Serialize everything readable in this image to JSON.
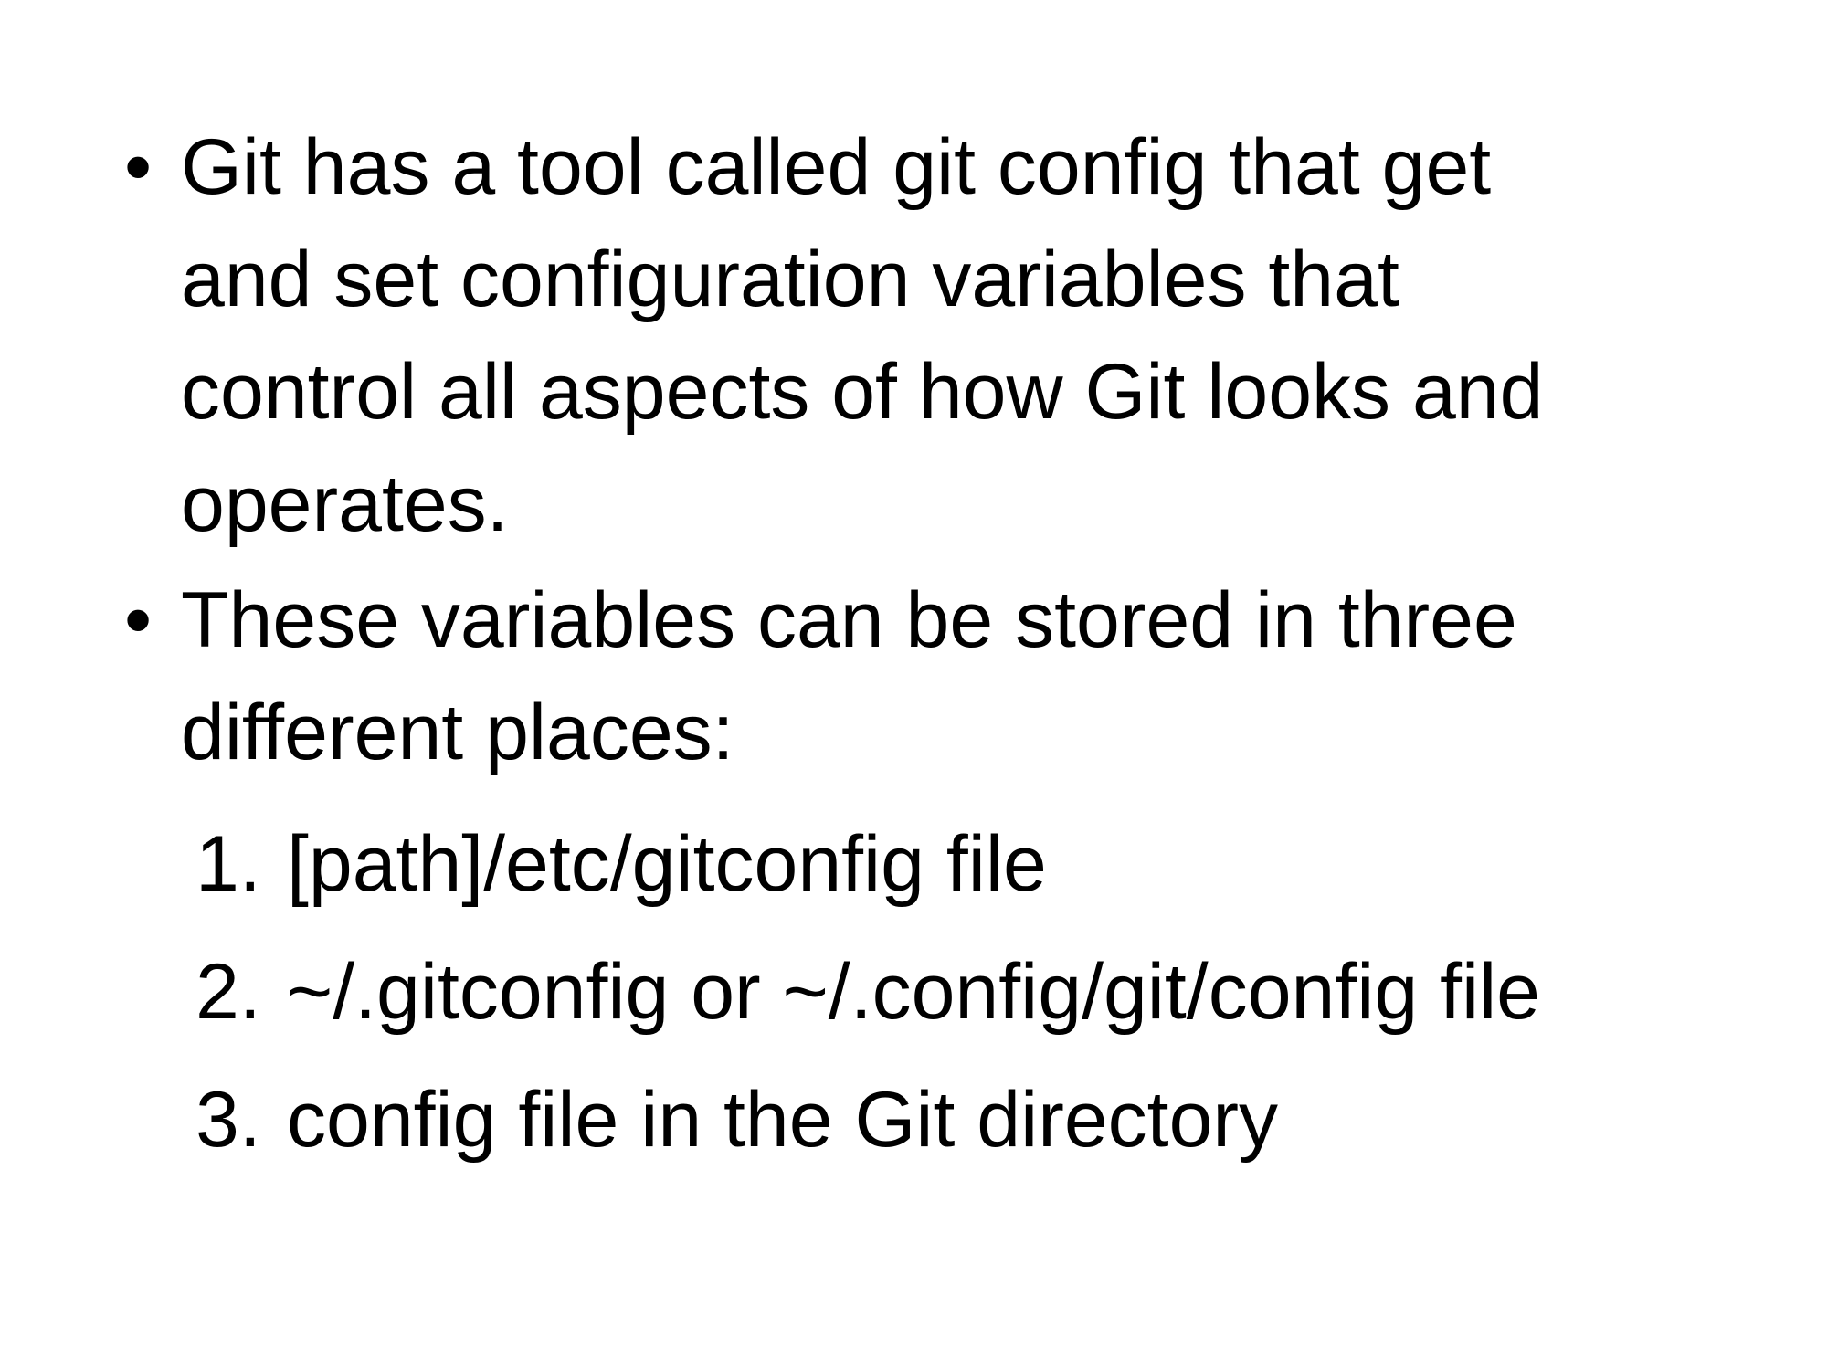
{
  "slide": {
    "bullets": [
      {
        "marker": "•",
        "lines": [
          "Git has a tool called git config that get",
          "and set configuration variables that",
          "control all aspects of how Git looks and",
          "operates."
        ]
      },
      {
        "marker": "•",
        "lines": [
          "These variables can be stored in three",
          "different places:"
        ]
      }
    ],
    "numbered": [
      {
        "number": "1.",
        "text": "[path]/etc/gitconfig file"
      },
      {
        "number": "2.",
        "text": "~/.gitconfig or ~/.config/git/config file"
      },
      {
        "number": "3.",
        "text": "config file in the Git directory"
      }
    ]
  }
}
